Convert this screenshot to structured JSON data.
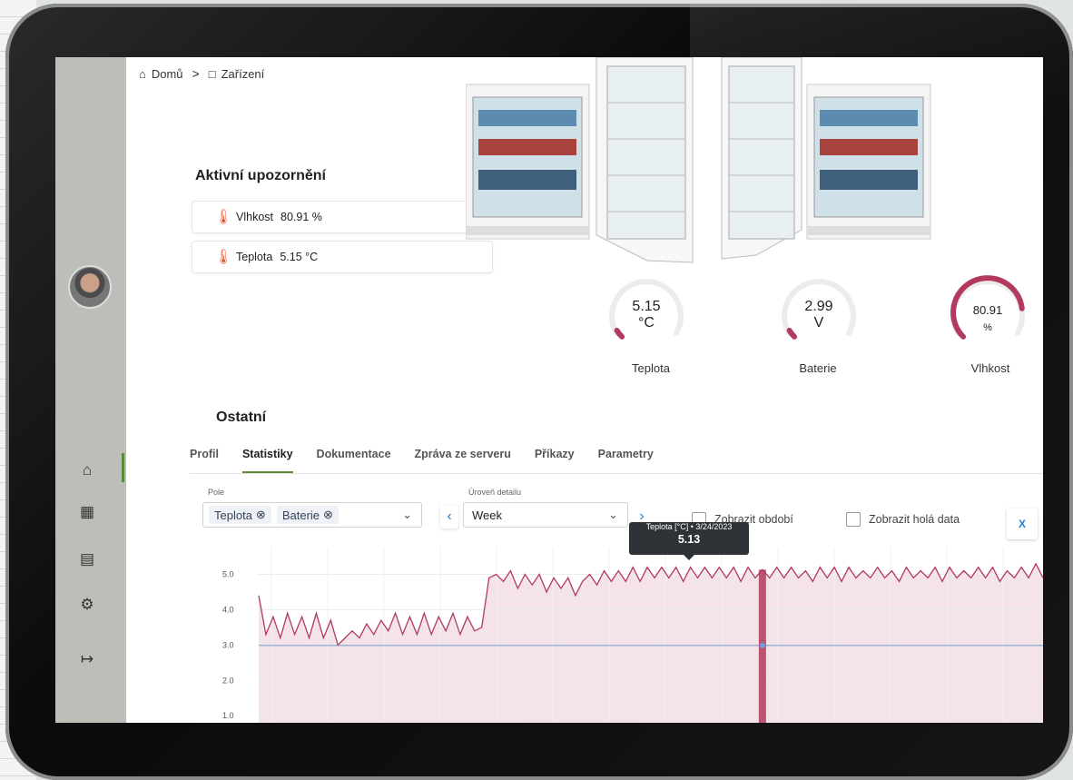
{
  "breadcrumb": {
    "home": "Domů",
    "separator": ">",
    "current": "Zařízení"
  },
  "alerts": {
    "title": "Aktivní upozornění",
    "items": [
      {
        "label": "Vlhkost",
        "value": "80.91 %"
      },
      {
        "label": "Teplota",
        "value": "5.15 °C"
      }
    ]
  },
  "partial_heading_fragment": "de",
  "gauges": [
    {
      "value": "5.15",
      "unit": "°C",
      "label": "Teplota",
      "fraction": 0.05
    },
    {
      "value": "2.99",
      "unit": "V",
      "label": "Baterie",
      "fraction": 0.05
    },
    {
      "value": "80.91",
      "unit": "%",
      "label": "Vlhkost",
      "fraction": 0.81
    }
  ],
  "section_other": "Ostatní",
  "tabs": [
    "Profil",
    "Statistiky",
    "Dokumentace",
    "Zpráva ze serveru",
    "Příkazy",
    "Parametry"
  ],
  "active_tab": "Statistiky",
  "controls": {
    "field_label": "Pole",
    "chips": [
      "Teplota",
      "Baterie"
    ],
    "detail_label": "Úroveň detailu",
    "detail_value": "Week",
    "show_period": "Zobrazit období",
    "show_raw": "Zobrazit holá data"
  },
  "tooltip": {
    "title": "Teplota [°C] • 3/24/2023",
    "value": "5.13"
  },
  "colors": {
    "accent_green": "#5a8a3a",
    "series": "#b23a5c",
    "link_blue": "#2a7ad8"
  },
  "chart_data": {
    "type": "area",
    "yticks": [
      "5.0",
      "4.0",
      "3.0",
      "2.0",
      "1.0"
    ],
    "ylim": [
      0.8,
      5.5
    ],
    "series": [
      {
        "name": "Teplota",
        "values": [
          4.4,
          3.3,
          3.8,
          3.2,
          3.9,
          3.3,
          3.8,
          3.2,
          3.9,
          3.2,
          3.7,
          3.0,
          3.2,
          3.4,
          3.2,
          3.6,
          3.3,
          3.7,
          3.4,
          3.9,
          3.3,
          3.8,
          3.3,
          3.9,
          3.3,
          3.8,
          3.4,
          3.9,
          3.3,
          3.8,
          3.4,
          3.5,
          4.9,
          5.0,
          4.8,
          5.1,
          4.6,
          5.0,
          4.7,
          5.0,
          4.5,
          4.9,
          4.6,
          4.9,
          4.4,
          4.8,
          5.0,
          4.7,
          5.1,
          4.8,
          5.1,
          4.8,
          5.2,
          4.8,
          5.2,
          4.9,
          5.2,
          4.9,
          5.2,
          4.8,
          5.2,
          4.9,
          5.2,
          4.9,
          5.2,
          4.9,
          5.2,
          4.8,
          5.2,
          4.9,
          5.13,
          4.9,
          5.2,
          4.9,
          5.2,
          4.9,
          5.1,
          4.8,
          5.2,
          4.9,
          5.2,
          4.8,
          5.2,
          4.9,
          5.1,
          4.9,
          5.2,
          4.9,
          5.1,
          4.8,
          5.2,
          4.9,
          5.1,
          4.9,
          5.2,
          4.8,
          5.2,
          4.9,
          5.1,
          4.9,
          5.2,
          4.9,
          5.2,
          4.8,
          5.1,
          4.9,
          5.2,
          4.9,
          5.3,
          4.9
        ]
      },
      {
        "name": "Baterie",
        "values": [
          2.99,
          2.99
        ]
      }
    ]
  }
}
